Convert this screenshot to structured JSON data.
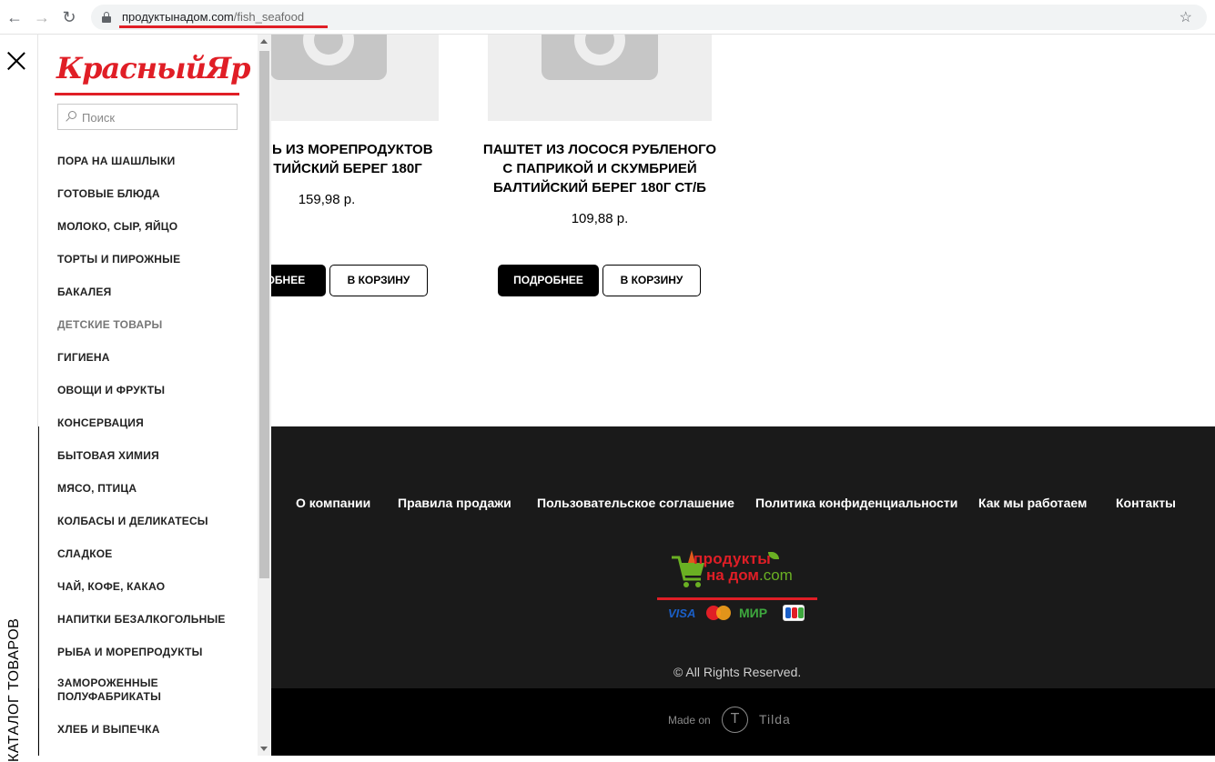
{
  "browser": {
    "url_host": "продуктынадом.com",
    "url_path": "/fish_seafood"
  },
  "products": [
    {
      "title_line1": "ЛЬ ИЗ МОРЕПРОДУКТОВ",
      "title_line2": "ТИЙСКИЙ БЕРЕГ 180Г",
      "price": "159,98  р.",
      "details_label": "РОБНЕЕ",
      "cart_label": "В КОРЗИНУ"
    },
    {
      "title_line1": "ПАШТЕТ ИЗ ЛОСОСЯ РУБЛЕНОГО",
      "title_line2": "С ПАПРИКОЙ И СКУМБРИЕЙ",
      "title_line3": "БАЛТИЙСКИЙ БЕРЕГ 180Г СТ/Б",
      "price": "109,88  р.",
      "details_label": "ПОДРОБНЕЕ",
      "cart_label": "В КОРЗИНУ"
    }
  ],
  "footer": {
    "links": [
      "О компании",
      "Правила продажи",
      "Пользовательское соглашение",
      "Политика конфиденциальности",
      "Как мы работаем",
      "Контакты"
    ],
    "logo_line1": "продукты",
    "logo_line2": "на дом",
    "logo_suffix": ".com",
    "payments": [
      "VISA",
      "МИР"
    ],
    "copyright": "© All Rights Reserved.",
    "made_on": "Made on",
    "tilda": "Tilda",
    "tilda_glyph": "T"
  },
  "sidebar": {
    "brand": "КрасныйЯр",
    "search_placeholder": "Поиск",
    "vertical_label": "КАТАЛОГ ТОВАРОВ",
    "items": [
      "ПОРА НА ШАШЛЫКИ",
      "ГОТОВЫЕ БЛЮДА",
      "МОЛОКО, СЫР, ЯЙЦО",
      "ТОРТЫ И ПИРОЖНЫЕ",
      "БАКАЛЕЯ",
      "ДЕТСКИЕ ТОВАРЫ",
      "ГИГИЕНА",
      "ОВОЩИ И ФРУКТЫ",
      "КОНСЕРВАЦИЯ",
      "БЫТОВАЯ ХИМИЯ",
      "МЯСО, ПТИЦА",
      "КОЛБАСЫ И ДЕЛИКАТЕСЫ",
      "СЛАДКОЕ",
      "ЧАЙ, КОФЕ, КАКАО",
      "НАПИТКИ БЕЗАЛКОГОЛЬНЫЕ",
      "РЫБА И МОРЕПРОДУКТЫ",
      "ЗАМОРОЖЕННЫЕ",
      "ПОЛУФАБРИКАТЫ",
      "ХЛЕБ И ВЫПЕЧКА"
    ]
  },
  "colors": {
    "brand_red": "#e01e26",
    "footer_bg": "#1a1a1a",
    "logo_green": "#6ab023"
  }
}
